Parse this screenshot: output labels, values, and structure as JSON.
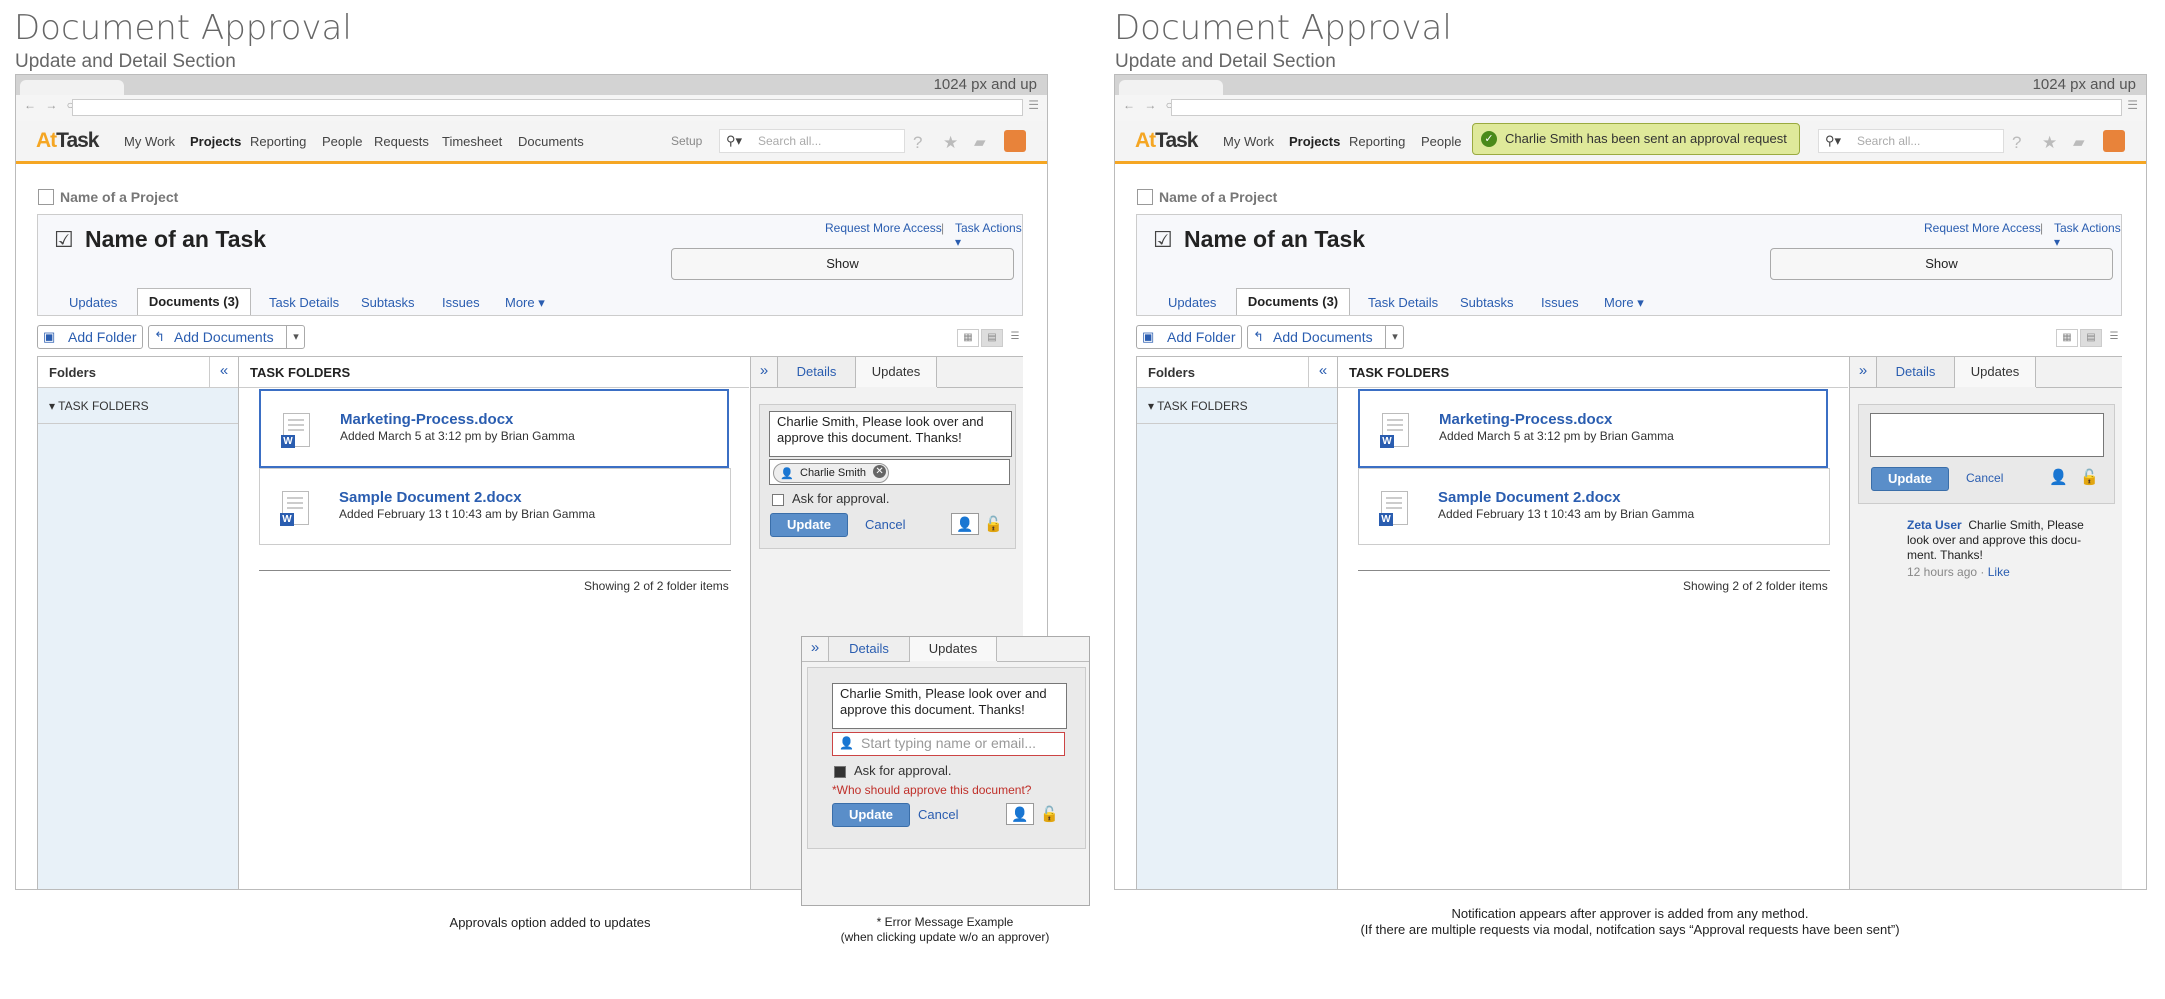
{
  "left": {
    "title": "Document Approval",
    "subtitle": "Update and Detail Section",
    "caption": "Approvals option added to updates"
  },
  "right": {
    "title": "Document Approval",
    "subtitle": "Update and Detail Section",
    "caption_line1": "Notification appears after approver is added from any method.",
    "caption_line2": "(If there are multiple requests via modal, notifcation says “Approval requests have been sent”)",
    "toast": "Charlie Smith has been sent an approval request"
  },
  "browser": {
    "size_note": "1024 px and up"
  },
  "nav": {
    "logo_a": "At",
    "logo_b": "Task",
    "items": [
      "My Work",
      "Projects",
      "Reporting",
      "People",
      "Requests",
      "Timesheet",
      "Documents"
    ],
    "setup": "Setup",
    "search_placeholder": "Search all..."
  },
  "project": {
    "name": "Name of a Project"
  },
  "task": {
    "title": "Name of an Task",
    "request_access": "Request More Access",
    "separator": "|",
    "task_actions": "Task Actions",
    "show": "Show",
    "tabs": [
      "Updates",
      "Documents (3)",
      "Task Details",
      "Subtasks",
      "Issues",
      "More"
    ]
  },
  "toolbar": {
    "add_folder": "Add Folder",
    "add_documents": "Add Documents"
  },
  "folders": {
    "header": "Folders",
    "task_folders": "TASK FOLDERS"
  },
  "main": {
    "header": "TASK FOLDERS",
    "documents": [
      {
        "name": "Marketing-Process.docx",
        "meta": "Added March 5 at 3:12 pm by Brian Gamma"
      },
      {
        "name": "Sample Document 2.docx",
        "meta": "Added February 13 t 10:43 am by Brian Gamma"
      }
    ],
    "showing": "Showing 2 of 2 folder items"
  },
  "updates_panel": {
    "tab_details": "Details",
    "tab_updates": "Updates",
    "message_line1": "Charlie Smith, Please look over and",
    "message_line2": "approve this document. Thanks!",
    "approver_tag": "Charlie Smith",
    "ask_approval": "Ask for approval.",
    "update_btn": "Update",
    "cancel": "Cancel"
  },
  "error_example": {
    "placeholder": "Start typing name or email...",
    "error": "*Who should approve this document?",
    "caption_line1": "* Error Message Example",
    "caption_line2": "(when clicking update w/o an approver)"
  },
  "feed": {
    "user": "Zeta User",
    "line1": "Charlie Smith, Please",
    "line2": "look over and approve this docu-",
    "line3": "ment. Thanks!",
    "ago": "12 hours ago",
    "dot": "·",
    "like": "Like"
  }
}
